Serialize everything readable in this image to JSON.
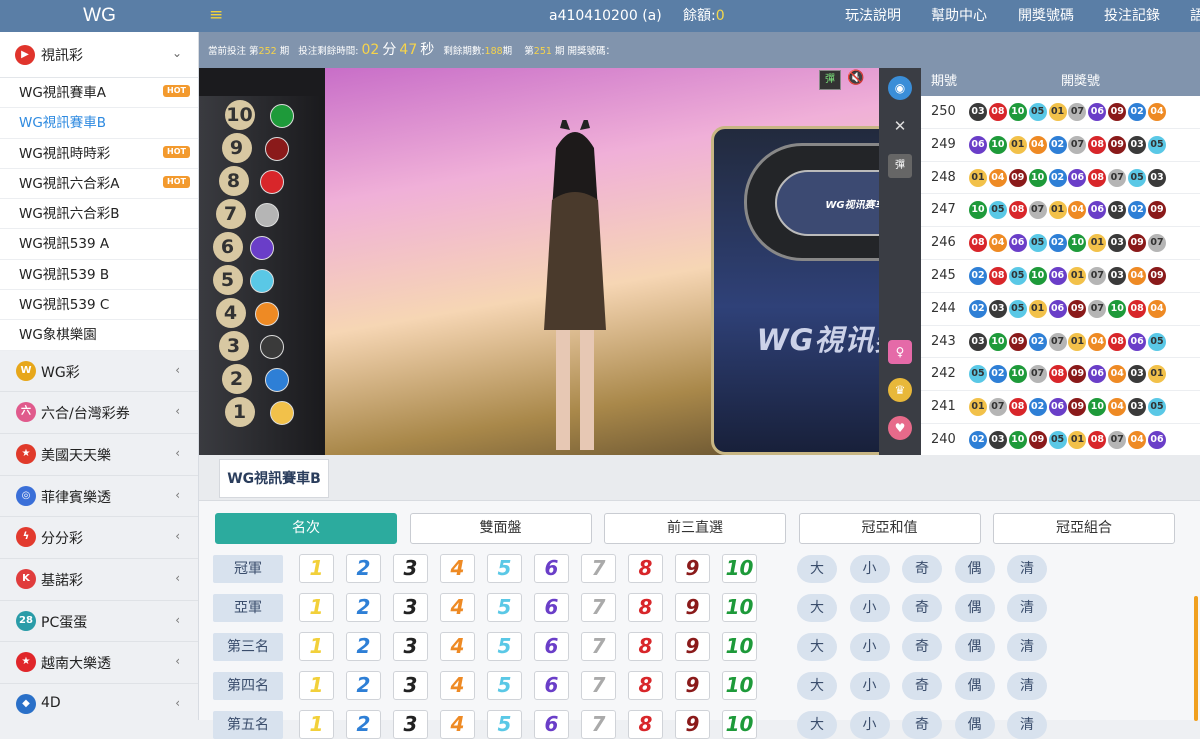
{
  "topbar": {
    "logo": "WG",
    "menu_icon": "≡",
    "account": "a410410200 (a)",
    "balance_label": "餘額:",
    "balance_value": "0",
    "nav": [
      "玩法說明",
      "幫助中心",
      "開獎號碼",
      "投注記錄",
      "語"
    ]
  },
  "sidebar": {
    "open_category": {
      "label": "視訊彩",
      "icon": "play-icon"
    },
    "items": [
      {
        "label": "WG視訊賽車A",
        "hot": "HOT"
      },
      {
        "label": "WG視訊賽車B",
        "active": true
      },
      {
        "label": "WG視訊時時彩",
        "hot": "HOT"
      },
      {
        "label": "WG視訊六合彩A",
        "hot": "HOT"
      },
      {
        "label": "WG視訊六合彩B"
      },
      {
        "label": "WG視訊539 A"
      },
      {
        "label": "WG視訊539 B"
      },
      {
        "label": "WG視訊539 C"
      },
      {
        "label": "WG象棋樂園"
      }
    ],
    "categories": [
      {
        "label": "WG彩",
        "icon_text": "W",
        "color": "#e7a71a"
      },
      {
        "label": "六合/台灣彩券",
        "icon_text": "六",
        "color": "#e05a8c"
      },
      {
        "label": "美國天天樂",
        "icon_text": "★",
        "color": "#e03a2a"
      },
      {
        "label": "菲律賓樂透",
        "icon_text": "◎",
        "color": "#3a6fd8"
      },
      {
        "label": "分分彩",
        "icon_text": "ϟ",
        "color": "#e23a2e"
      },
      {
        "label": "基諾彩",
        "icon_text": "K",
        "color": "#e03c3c"
      },
      {
        "label": "PC蛋蛋",
        "icon_text": "28",
        "color": "#2a9ca8"
      },
      {
        "label": "越南大樂透",
        "icon_text": "★",
        "color": "#e0262a"
      },
      {
        "label": "4D",
        "icon_text": "◆",
        "color": "#2a70c8"
      }
    ]
  },
  "infobar": {
    "current_label": "當前投注 第",
    "current_period": "252",
    "period_unit": "期",
    "time_label": "投注剩餘時間:",
    "minutes": "02",
    "min_unit": "分",
    "seconds": "47",
    "sec_unit": "秒",
    "remaining_label": "剩餘期數:",
    "remaining": "188",
    "remaining_unit": "期",
    "last_prefix": "第",
    "last_period": "251",
    "last_suffix": "期 開獎號碼："
  },
  "video": {
    "machine_title": "WG視讯赛车",
    "track_title": "WG视讯赛车",
    "rack_numbers": [
      "10",
      "9",
      "8",
      "7",
      "6",
      "5",
      "4",
      "3",
      "2",
      "1"
    ]
  },
  "results": {
    "header_period": "期號",
    "header_draw": "開獎號",
    "rows": [
      {
        "period": "250",
        "balls": [
          "03",
          "08",
          "10",
          "05",
          "01",
          "07",
          "06",
          "09",
          "02",
          "04"
        ]
      },
      {
        "period": "249",
        "balls": [
          "06",
          "10",
          "01",
          "04",
          "02",
          "07",
          "08",
          "09",
          "03",
          "05"
        ]
      },
      {
        "period": "248",
        "balls": [
          "01",
          "04",
          "09",
          "10",
          "02",
          "06",
          "08",
          "07",
          "05",
          "03"
        ]
      },
      {
        "period": "247",
        "balls": [
          "10",
          "05",
          "08",
          "07",
          "01",
          "04",
          "06",
          "03",
          "02",
          "09"
        ]
      },
      {
        "period": "246",
        "balls": [
          "08",
          "04",
          "06",
          "05",
          "02",
          "10",
          "01",
          "03",
          "09",
          "07"
        ]
      },
      {
        "period": "245",
        "balls": [
          "02",
          "08",
          "05",
          "10",
          "06",
          "01",
          "07",
          "03",
          "04",
          "09"
        ]
      },
      {
        "period": "244",
        "balls": [
          "02",
          "03",
          "05",
          "01",
          "06",
          "09",
          "07",
          "10",
          "08",
          "04"
        ]
      },
      {
        "period": "243",
        "balls": [
          "03",
          "10",
          "09",
          "02",
          "07",
          "01",
          "04",
          "08",
          "06",
          "05"
        ]
      },
      {
        "period": "242",
        "balls": [
          "05",
          "02",
          "10",
          "07",
          "08",
          "09",
          "06",
          "04",
          "03",
          "01"
        ]
      },
      {
        "period": "241",
        "balls": [
          "01",
          "07",
          "08",
          "02",
          "06",
          "09",
          "10",
          "04",
          "03",
          "05"
        ]
      },
      {
        "period": "240",
        "balls": [
          "02",
          "03",
          "10",
          "09",
          "05",
          "01",
          "08",
          "07",
          "04",
          "06"
        ]
      }
    ],
    "ball_colors": {
      "01": "#f2c14a",
      "02": "#2e7fd6",
      "03": "#3a3a3a",
      "04": "#ee8a24",
      "05": "#5ac8e6",
      "06": "#6a3ec8",
      "07": "#b5b5b5",
      "08": "#d8262a",
      "09": "#8a1a1a",
      "10": "#1e9a3a"
    }
  },
  "game_tab": "WG視訊賽車B",
  "bet_tabs": [
    "名次",
    "雙面盤",
    "前三直選",
    "冠亞和值",
    "冠亞組合"
  ],
  "positions": [
    "冠軍",
    "亞軍",
    "第三名",
    "第四名",
    "第五名"
  ],
  "numbers": [
    "1",
    "2",
    "3",
    "4",
    "5",
    "6",
    "7",
    "8",
    "9",
    "10"
  ],
  "number_colors": [
    "#f2d03a",
    "#2e7fd6",
    "#222222",
    "#ee8a24",
    "#5ac8e6",
    "#6a3ec8",
    "#aaaaaa",
    "#d8262a",
    "#8a1a1a",
    "#1e9a3a"
  ],
  "options": [
    "大",
    "小",
    "奇",
    "偶",
    "清"
  ]
}
